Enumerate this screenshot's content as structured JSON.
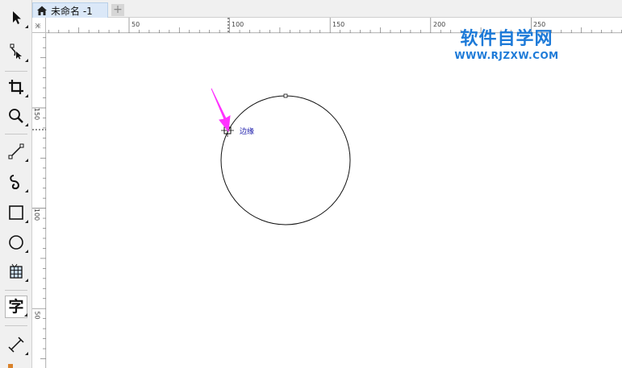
{
  "document": {
    "tab_title": "未命名 -1",
    "add_tab_glyph": "+"
  },
  "toolbox": {
    "tools": [
      {
        "name": "pick-tool",
        "icon": "arrow-pointer-icon"
      },
      {
        "name": "shape-tool",
        "icon": "node-edit-icon"
      },
      {
        "name": "crop-tool",
        "icon": "crop-icon"
      },
      {
        "name": "zoom-tool",
        "icon": "magnifier-icon"
      },
      {
        "name": "freehand-tool",
        "icon": "line-icon"
      },
      {
        "name": "artistic-media-tool",
        "icon": "curve-icon"
      },
      {
        "name": "rectangle-tool",
        "icon": "rectangle-icon"
      },
      {
        "name": "ellipse-tool",
        "icon": "ellipse-icon"
      },
      {
        "name": "graph-paper-tool",
        "icon": "grid-table-icon"
      },
      {
        "name": "text-tool",
        "icon": "text-icon",
        "label": "字",
        "active": true
      },
      {
        "name": "dimension-tool",
        "icon": "dimension-line-icon"
      }
    ]
  },
  "rulers": {
    "horizontal_labels": [
      "50",
      "100",
      "150",
      "200",
      "250"
    ],
    "vertical_labels": [
      "150",
      "100",
      "50"
    ],
    "corner_label": "米"
  },
  "canvas": {
    "snap_hint": "边缘",
    "accent_color": "#ff33ff",
    "watermark": {
      "title": "软件自学网",
      "url": "WWW.RJZXW.COM",
      "color": "#1d7ad8"
    }
  }
}
